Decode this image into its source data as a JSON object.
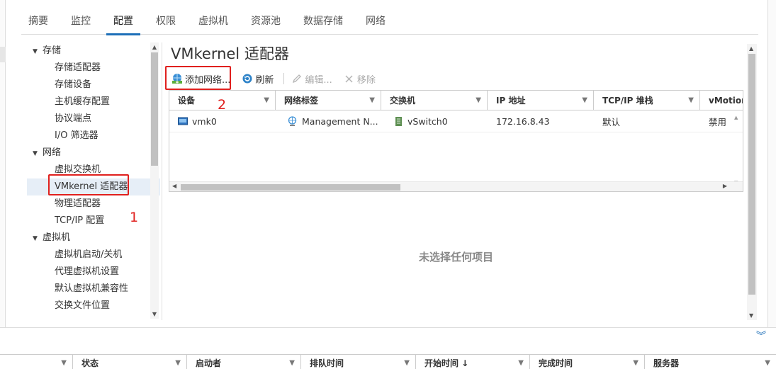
{
  "tabs": [
    "摘要",
    "监控",
    "配置",
    "权限",
    "虚拟机",
    "资源池",
    "数据存储",
    "网络"
  ],
  "active_tab_index": 2,
  "tree": {
    "storage": {
      "label": "存储",
      "items": [
        "存储适配器",
        "存储设备",
        "主机缓存配置",
        "协议端点",
        "I/O 筛选器"
      ]
    },
    "network": {
      "label": "网络",
      "items": [
        "虚拟交换机",
        "VMkernel 适配器",
        "物理适配器",
        "TCP/IP 配置"
      ]
    },
    "vm": {
      "label": "虚拟机",
      "items": [
        "虚拟机启动/关机",
        "代理虚拟机设置",
        "默认虚拟机兼容性",
        "交换文件位置"
      ]
    },
    "selected_item": "VMkernel 适配器"
  },
  "panel": {
    "title": "VMkernel 适配器",
    "toolbar": {
      "add": "添加网络...",
      "refresh": "刷新",
      "edit": "编辑...",
      "remove": "移除"
    },
    "columns": [
      "设备",
      "网络标签",
      "交换机",
      "IP 地址",
      "TCP/IP 堆栈",
      "vMotion"
    ],
    "rows": [
      {
        "device": "vmk0",
        "network_label": "Management N...",
        "switch": "vSwitch0",
        "ip": "172.16.8.43",
        "stack": "默认",
        "vmotion": "禁用"
      }
    ],
    "empty_message": "未选择任何项目"
  },
  "tasks": {
    "columns": [
      "状态",
      "启动者",
      "排队时间",
      "开始时间 ↓",
      "完成时间",
      "服务器"
    ]
  },
  "annotations": {
    "one": "1",
    "two": "2"
  },
  "colors": {
    "accent": "#1d6fb8",
    "annotation": "#e0201e"
  }
}
